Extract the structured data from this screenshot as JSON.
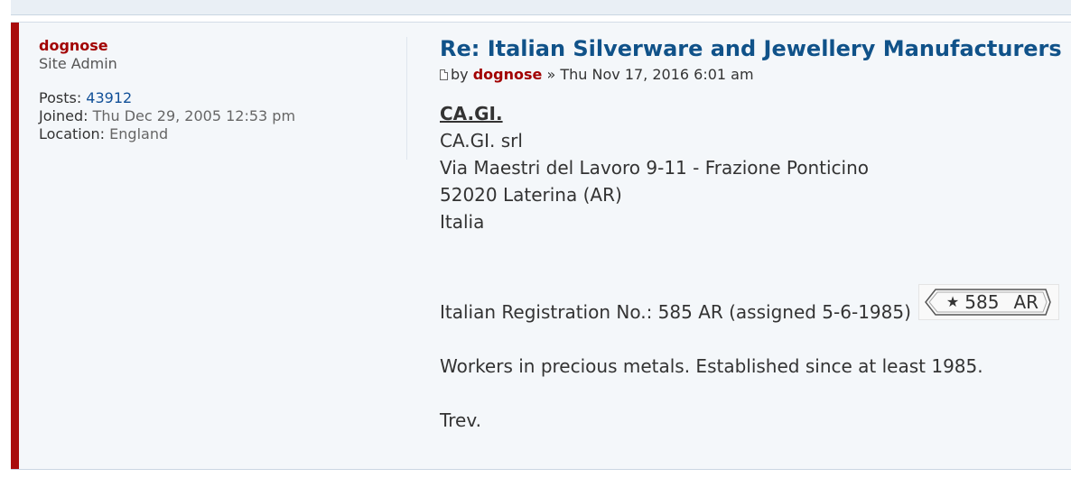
{
  "profile": {
    "username": "dognose",
    "rank": "Site Admin",
    "posts_label": "Posts:",
    "posts_value": "43912",
    "joined_label": "Joined:",
    "joined_value": "Thu Dec 29, 2005 12:53 pm",
    "location_label": "Location:",
    "location_value": "England"
  },
  "post": {
    "title": "Re: Italian Silverware and Jewellery Manufacturers",
    "by_label": "by",
    "author": "dognose",
    "separator": "»",
    "date": "Thu Nov 17, 2016 6:01 am",
    "icon": "post-icon",
    "company_heading": "CA.GI.",
    "address_lines": [
      "CA.GI. srl",
      "Via Maestri del Lavoro 9-11 - Frazione Ponticino",
      "52020 Laterina (AR)",
      "Italia"
    ],
    "registration": "Italian Registration No.: 585 AR (assigned 5-6-1985)",
    "hallmark": {
      "star": "★",
      "number": "585",
      "code": "AR"
    },
    "description": "Workers in precious metals. Established since at least 1985.",
    "signature": "Trev."
  },
  "colors": {
    "accent_bar": "#a90c0c",
    "username": "#a20000",
    "title": "#105289",
    "post_background": "#f4f7fa"
  }
}
